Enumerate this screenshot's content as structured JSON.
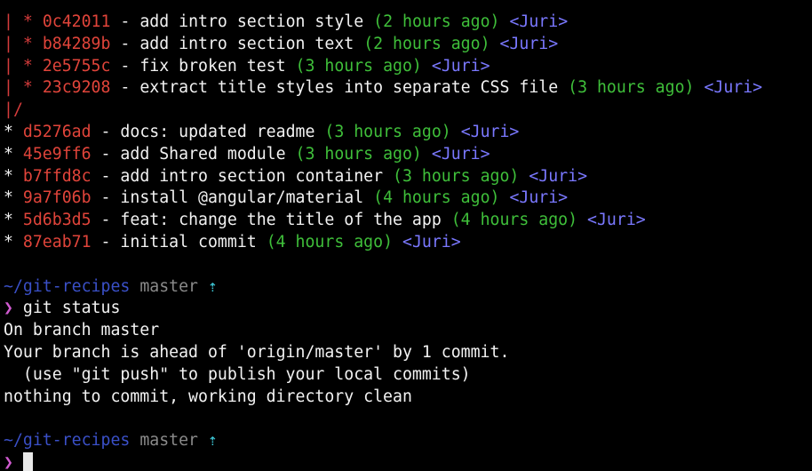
{
  "log": [
    {
      "graph": "| * ",
      "hash": "0c42011",
      "sep": " - ",
      "message": "add intro section style",
      "ago": "(2 hours ago)",
      "author": "<Juri>"
    },
    {
      "graph": "| * ",
      "hash": "b84289b",
      "sep": " - ",
      "message": "add intro section text",
      "ago": "(2 hours ago)",
      "author": "<Juri>"
    },
    {
      "graph": "| * ",
      "hash": "2e5755c",
      "sep": " - ",
      "message": "fix broken test",
      "ago": "(3 hours ago)",
      "author": "<Juri>"
    },
    {
      "graph": "| * ",
      "hash": "23c9208",
      "sep": " - ",
      "message": "extract title styles into separate CSS file",
      "ago": "(3 hours ago)",
      "author": "<Juri>"
    },
    {
      "graph_only": "|/"
    },
    {
      "graph": "* ",
      "hash": "d5276ad",
      "sep": " - ",
      "message": "docs: updated readme",
      "ago": "(3 hours ago)",
      "author": "<Juri>"
    },
    {
      "graph": "* ",
      "hash": "45e9ff6",
      "sep": " - ",
      "message": "add Shared module",
      "ago": "(3 hours ago)",
      "author": "<Juri>"
    },
    {
      "graph": "* ",
      "hash": "b7ffd8c",
      "sep": " - ",
      "message": "add intro section container",
      "ago": "(3 hours ago)",
      "author": "<Juri>"
    },
    {
      "graph": "* ",
      "hash": "9a7f06b",
      "sep": " - ",
      "message": "install @angular/material",
      "ago": "(4 hours ago)",
      "author": "<Juri>"
    },
    {
      "graph": "* ",
      "hash": "5d6b3d5",
      "sep": " - ",
      "message": "feat: change the title of the app",
      "ago": "(4 hours ago)",
      "author": "<Juri>"
    },
    {
      "graph": "* ",
      "hash": "87eab71",
      "sep": " - ",
      "message": "initial commit",
      "ago": "(4 hours ago)",
      "author": "<Juri>"
    }
  ],
  "prompt1": {
    "path": "~/git-recipes",
    "branch": "master",
    "ahead_arrow": "⇡",
    "symbol": "❯",
    "command": "git status"
  },
  "output": [
    "On branch master",
    "Your branch is ahead of 'origin/master' by 1 commit.",
    "  (use \"git push\" to publish your local commits)",
    "nothing to commit, working directory clean"
  ],
  "prompt2": {
    "path": "~/git-recipes",
    "branch": "master",
    "ahead_arrow": "⇡",
    "symbol": "❯"
  },
  "colors": {
    "background": "#000000",
    "foreground": "#f2f2f2",
    "hash": "#e0443a",
    "graph": "#d63c3c",
    "relative_time": "#3fbf3a",
    "author": "#7a78ff",
    "path": "#3a50c8",
    "branch": "#8a8a8a",
    "ahead_arrow": "#3ec9d8",
    "prompt_symbol": "#d05ad0"
  }
}
